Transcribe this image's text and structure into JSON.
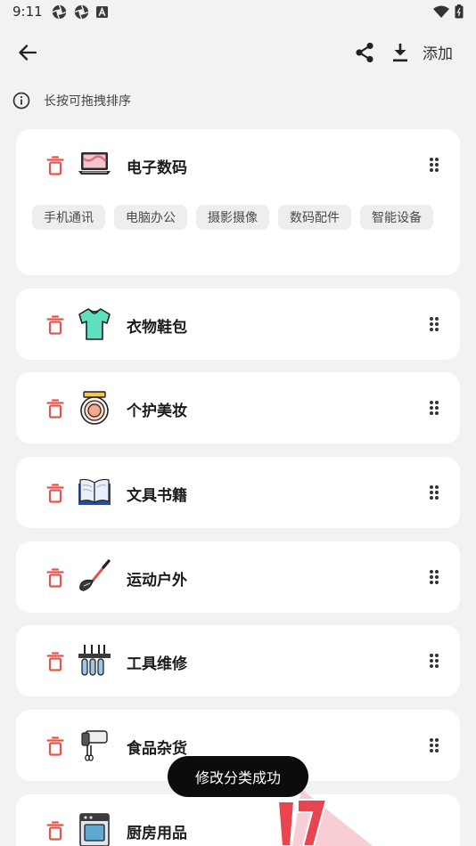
{
  "status_bar": {
    "time": "9:11",
    "left_icons": [
      "aperture-icon",
      "aperture-icon",
      "a-badge-icon"
    ],
    "right_icons": [
      "wifi-icon",
      "battery-icon"
    ]
  },
  "app_bar": {
    "back_icon": "arrow-left-icon",
    "share_icon": "share-icon",
    "download_icon": "download-icon",
    "add_label": "添加"
  },
  "hint": {
    "icon": "info-icon",
    "text": "长按可拖拽排序"
  },
  "categories": [
    {
      "name": "电子数码",
      "icon": "laptop-icon",
      "subcategories": [
        "手机通讯",
        "电脑办公",
        "摄影摄像",
        "数码配件",
        "智能设备"
      ]
    },
    {
      "name": "衣物鞋包",
      "icon": "tshirt-icon"
    },
    {
      "name": "个护美妆",
      "icon": "compact-mirror-icon"
    },
    {
      "name": "文具书籍",
      "icon": "open-book-icon"
    },
    {
      "name": "运动户外",
      "icon": "racket-icon"
    },
    {
      "name": "工具维修",
      "icon": "tool-rack-icon"
    },
    {
      "name": "食品杂货",
      "icon": "hand-mixer-icon"
    },
    {
      "name": "厨房用品",
      "icon": "oven-icon"
    }
  ],
  "toast": {
    "text": "修改分类成功"
  },
  "colors": {
    "background": "#f2f2f4",
    "card": "#ffffff",
    "delete": "#e5534b",
    "chip_bg": "#eeeef0",
    "toast_bg": "#0c0c0c"
  }
}
